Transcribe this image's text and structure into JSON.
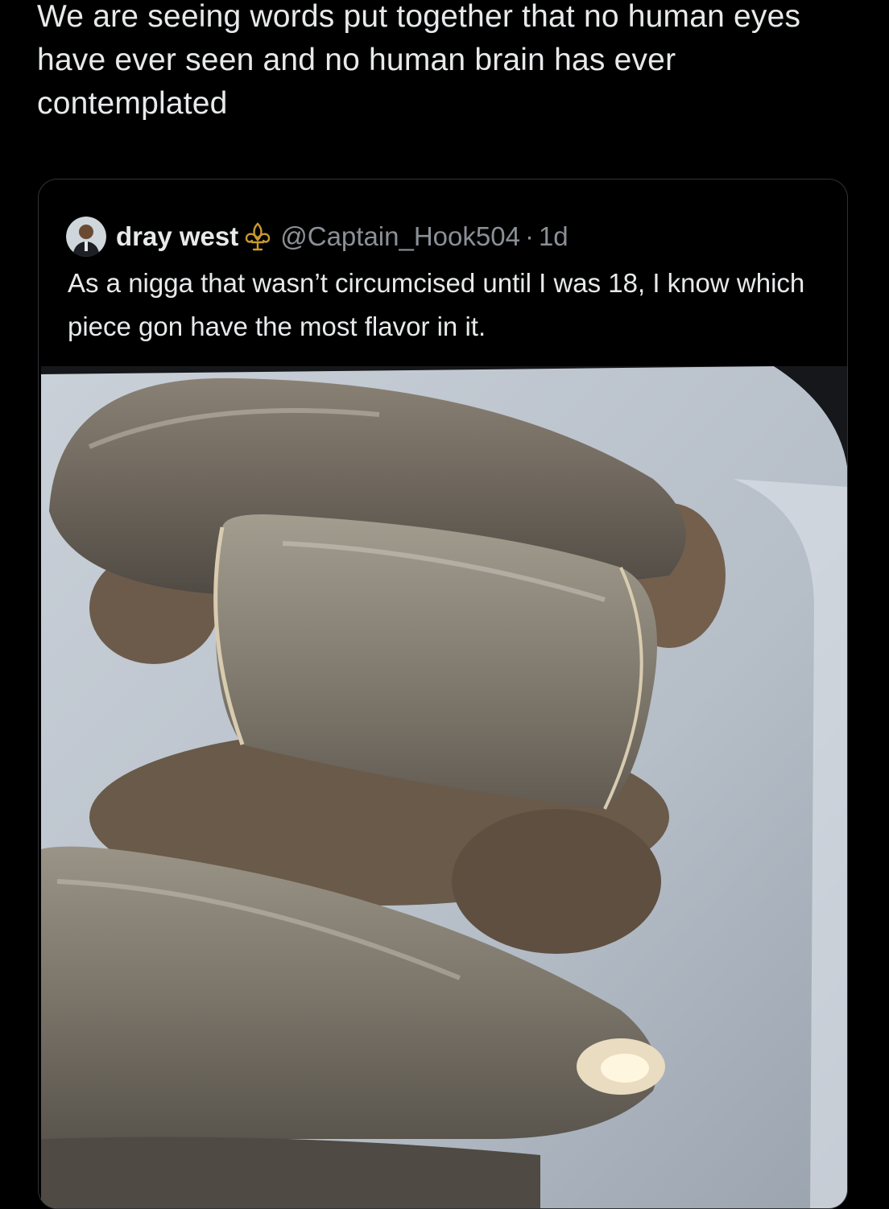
{
  "post": {
    "text": "We are seeing words put together that no human eyes have ever seen and no human brain has ever contemplated"
  },
  "quote": {
    "display_name": "dray west",
    "badge_icon": "fleur-de-lis-icon",
    "handle": "@Captain_Hook504",
    "separator": "·",
    "timestamp": "1d",
    "text": "As a nigga that wasn’t circumcised until I was 18, I know which piece gon have the most flavor in it.",
    "image_alt": "Boudin sausage links in a styrofoam container"
  },
  "colors": {
    "background": "#000000",
    "text_primary": "#e7e9ea",
    "text_secondary": "#8b9096",
    "card_border": "#2f3336",
    "fleur_gold": "#c9982f"
  }
}
